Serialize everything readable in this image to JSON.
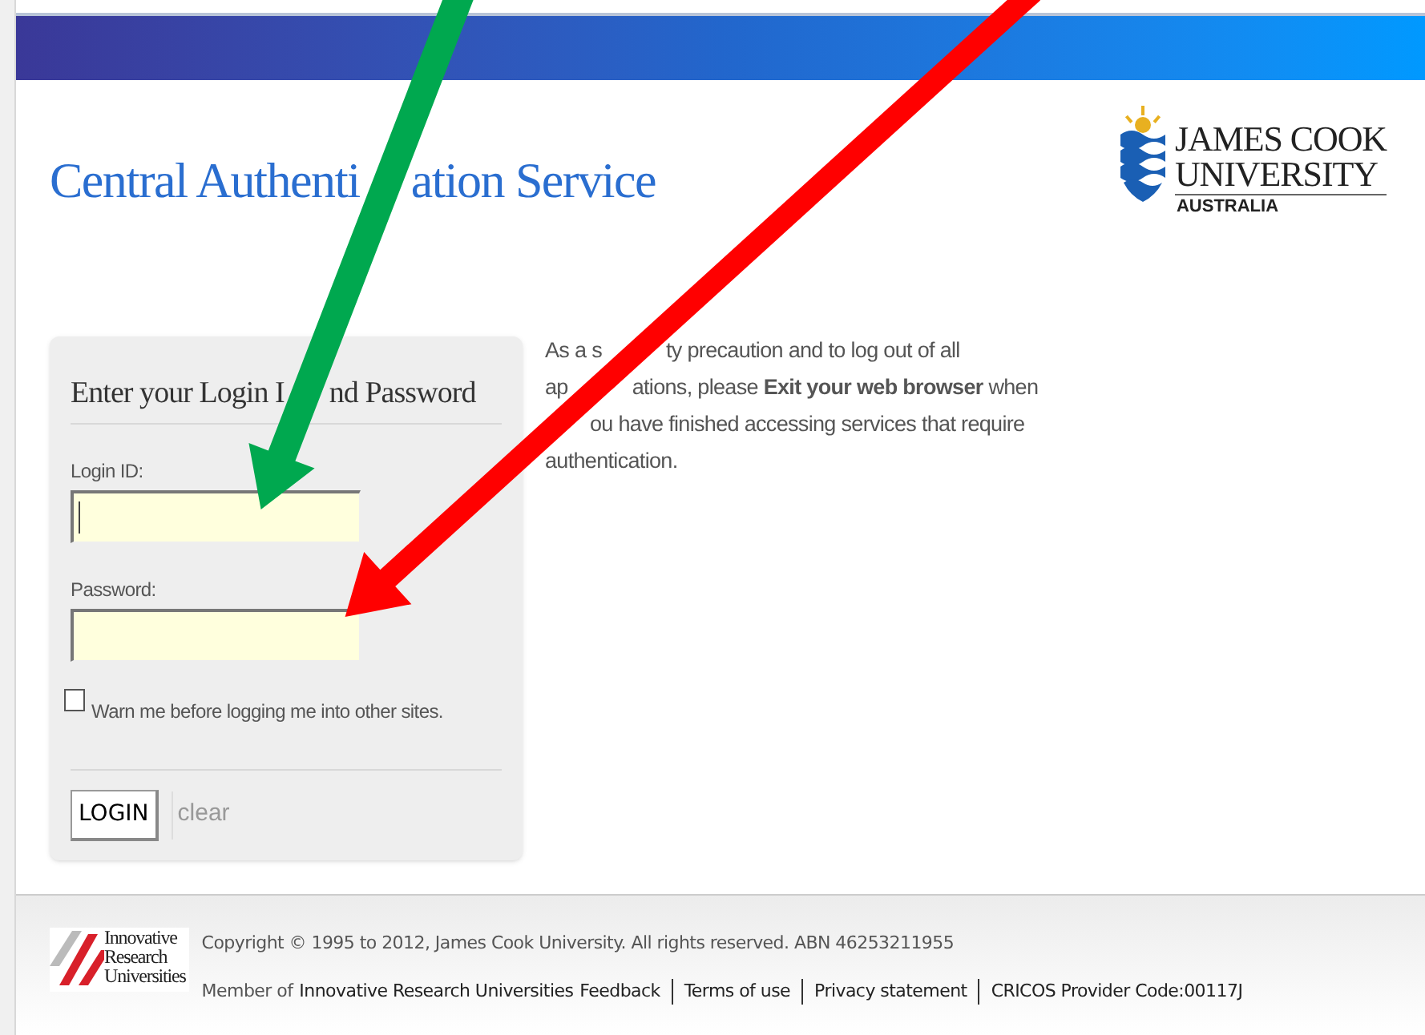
{
  "header": {
    "title_parts": [
      "Central Authenti",
      "ation Service"
    ]
  },
  "logo": {
    "line_1": "JAMES COOK",
    "line_2": "UNIVERSITY",
    "line_3": "AUSTRALIA"
  },
  "login_form": {
    "heading_parts": [
      "Enter your Login I",
      "nd Password"
    ],
    "fields": [
      {
        "label": "Login ID:",
        "focused": true
      },
      {
        "label": "Password:",
        "focused": false
      }
    ],
    "warn_checkbox": {
      "label": "Warn me before logging me into other sites.",
      "checked": false
    },
    "login_button": "LOGIN",
    "clear_link": "clear"
  },
  "notice_lines": [
    [
      "As a s",
      "ty precaution and to log out of all"
    ],
    [
      "ap",
      "ations, please **Exit your web browser** when"
    ],
    [
      "ou have finished accessing services that require"
    ],
    [
      "authentication."
    ]
  ],
  "footer": {
    "iru_logo": [
      "Innovative",
      "Research",
      "Universities"
    ],
    "copyright": "Copyright © 1995 to 2012, James Cook University. All rights reserved. ABN 46253211955",
    "member_prefix": "Member of",
    "links": [
      "Innovative Research Universities",
      "Feedback",
      "Terms of use",
      "Privacy statement",
      "CRICOS Provider Code:00117J"
    ]
  },
  "annotations": [
    {
      "kind": "arrow",
      "color": "#00a84f"
    },
    {
      "kind": "arrow",
      "color": "#ff0000"
    }
  ]
}
